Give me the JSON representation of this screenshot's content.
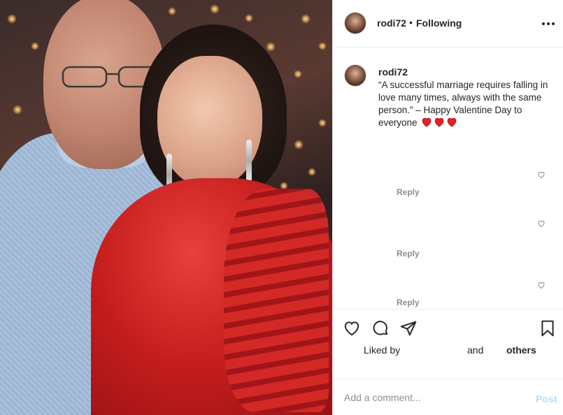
{
  "header": {
    "username": "rodi72",
    "separator": "•",
    "follow_status": "Following",
    "more_icon": "more-horizontal-icon"
  },
  "caption": {
    "username": "rodi72",
    "text": "“A successful marriage requires falling in love many times, always with the same person.” – Happy Valentine Day to everyone",
    "emoji": "heart-emoji x3",
    "emoji_color": "#ed1c24"
  },
  "comments": [
    {
      "reply_label": "Reply"
    },
    {
      "reply_label": "Reply"
    },
    {
      "reply_label": "Reply"
    }
  ],
  "actions": {
    "like_icon": "heart-outline-icon",
    "comment_icon": "comment-icon",
    "share_icon": "share-icon",
    "save_icon": "bookmark-icon"
  },
  "likes": {
    "liked_by": "Liked by",
    "and": "and",
    "others": "others"
  },
  "comment_box": {
    "placeholder": "Add a comment...",
    "post_label": "Post"
  },
  "colors": {
    "text": "#262626",
    "muted": "#8e8e8e",
    "post_disabled": "#b2dffc",
    "divider": "#efefef"
  }
}
